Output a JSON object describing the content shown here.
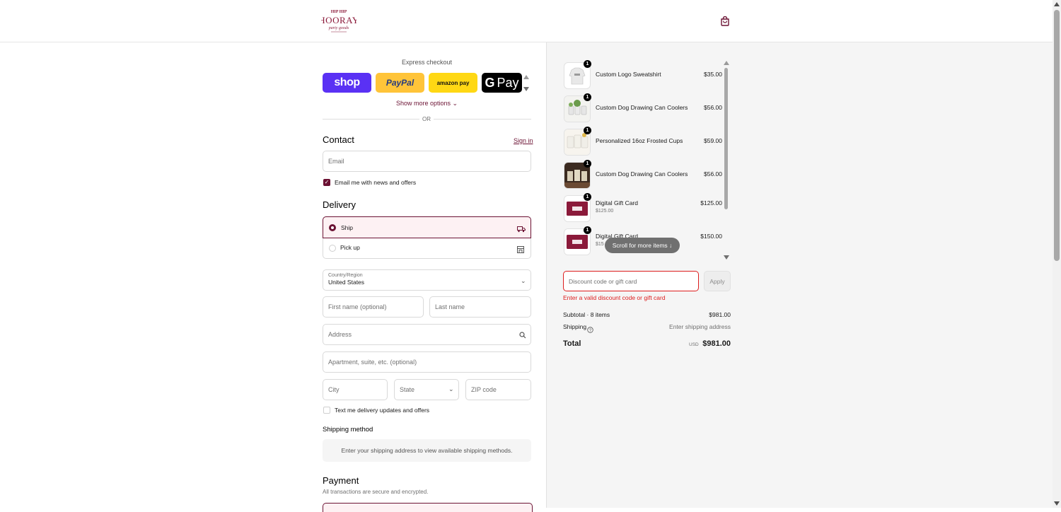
{
  "colors": {
    "accent": "#6b1233",
    "error": "#dd1d1d",
    "shop": "#5a31f4",
    "paypal": "#ffc439",
    "amazon": "#ffd814"
  },
  "header": {
    "logo_text_top": "HIP HIP",
    "logo_text_main": "HOORAY",
    "logo_text_sub": "party goods",
    "cart_icon": "shopping-bag-icon"
  },
  "express": {
    "label": "Express checkout",
    "shop": "shop",
    "paypal": "PayPal",
    "amazon": "amazon pay",
    "gpay_g": "G",
    "gpay": "Pay",
    "show_more": "Show more options ⌄",
    "or": "OR"
  },
  "contact": {
    "title": "Contact",
    "sign_in": "Sign in",
    "email_placeholder": "Email",
    "news_label": "Email me with news and offers",
    "news_checked": true
  },
  "delivery": {
    "title": "Delivery",
    "ship": "Ship",
    "pickup": "Pick up",
    "country_label": "Country/Region",
    "country_value": "United States",
    "first_name": "First name (optional)",
    "last_name": "Last name",
    "address": "Address",
    "apartment": "Apartment, suite, etc. (optional)",
    "city": "City",
    "state": "State",
    "zip": "ZIP code",
    "sms_label": "Text me delivery updates and offers"
  },
  "shipping_method": {
    "title": "Shipping method",
    "message": "Enter your shipping address to view available shipping methods."
  },
  "payment": {
    "title": "Payment",
    "subtitle": "All transactions are secure and encrypted."
  },
  "cart": {
    "items": [
      {
        "name": "Custom Logo Sweatshirt",
        "price": "$35.00",
        "qty": "1",
        "sub": ""
      },
      {
        "name": "Custom Dog Drawing Can Coolers",
        "price": "$56.00",
        "qty": "1",
        "sub": ""
      },
      {
        "name": "Personalized 16oz Frosted Cups",
        "price": "$59.00",
        "qty": "1",
        "sub": ""
      },
      {
        "name": "Custom Dog Drawing Can Coolers",
        "price": "$56.00",
        "qty": "1",
        "sub": ""
      },
      {
        "name": "Digital Gift Card",
        "price": "$125.00",
        "qty": "1",
        "sub": "$125.00"
      },
      {
        "name": "Digital Gift Card",
        "price": "$150.00",
        "qty": "1",
        "sub": "$15"
      }
    ],
    "scroll_pill": "Scroll for more items ↓",
    "discount_placeholder": "Discount code or gift card",
    "apply": "Apply",
    "error": "Enter a valid discount code or gift card",
    "subtotal_label": "Subtotal · 8 items",
    "subtotal_value": "$981.00",
    "shipping_label": "Shipping",
    "shipping_value": "Enter shipping address",
    "total_label": "Total",
    "currency": "USD",
    "total_value": "$981.00"
  }
}
